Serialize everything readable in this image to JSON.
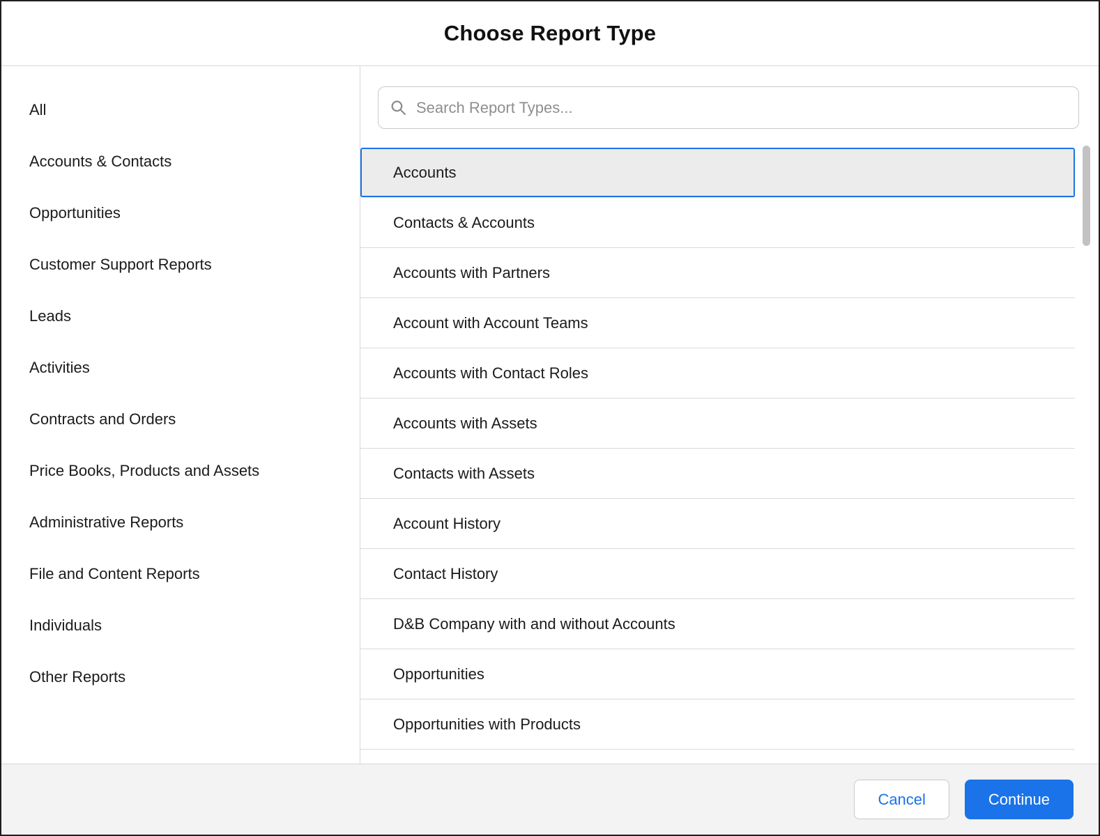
{
  "modal": {
    "title": "Choose Report Type"
  },
  "sidebar": {
    "categories": [
      "All",
      "Accounts & Contacts",
      "Opportunities",
      "Customer Support Reports",
      "Leads",
      "Activities",
      "Contracts and Orders",
      "Price Books, Products and Assets",
      "Administrative Reports",
      "File and Content Reports",
      "Individuals",
      "Other Reports"
    ]
  },
  "search": {
    "placeholder": "Search Report Types...",
    "value": ""
  },
  "report_types": [
    {
      "label": "Accounts",
      "selected": true
    },
    {
      "label": "Contacts & Accounts",
      "selected": false
    },
    {
      "label": "Accounts with Partners",
      "selected": false
    },
    {
      "label": "Account with Account Teams",
      "selected": false
    },
    {
      "label": "Accounts with Contact Roles",
      "selected": false
    },
    {
      "label": "Accounts with Assets",
      "selected": false
    },
    {
      "label": "Contacts with Assets",
      "selected": false
    },
    {
      "label": "Account History",
      "selected": false
    },
    {
      "label": "Contact History",
      "selected": false
    },
    {
      "label": "D&B Company with and without Accounts",
      "selected": false
    },
    {
      "label": "Opportunities",
      "selected": false
    },
    {
      "label": "Opportunities with Products",
      "selected": false
    }
  ],
  "footer": {
    "cancel_label": "Cancel",
    "continue_label": "Continue"
  },
  "colors": {
    "accent": "#1a73e8",
    "selected_row_bg": "#ececec",
    "row_border": "#d9d9d9",
    "footer_bg": "#f3f3f3",
    "modal_border": "#1f1f1f",
    "placeholder_text": "#8e8e8e"
  }
}
